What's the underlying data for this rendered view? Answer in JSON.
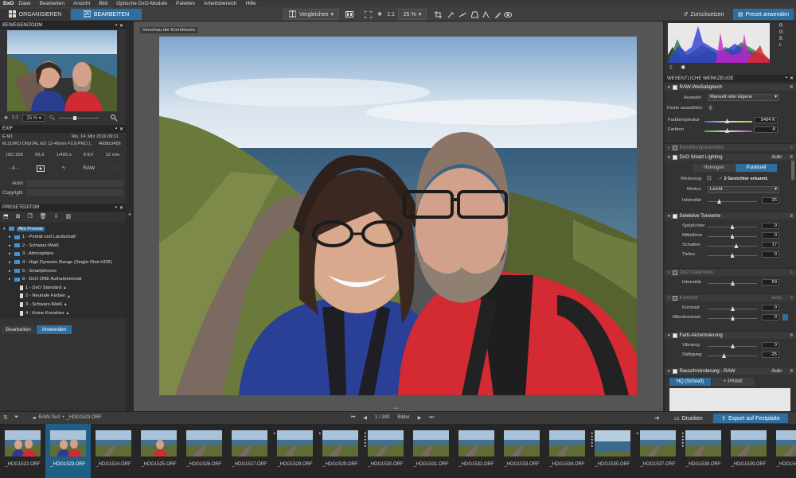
{
  "menubar": {
    "logo": "DxO",
    "items": [
      "Datei",
      "Bearbeiten",
      "Ansicht",
      "Bild",
      "Optische DxO-Module",
      "Paletten",
      "Arbeitsbereich",
      "Hilfe"
    ]
  },
  "toolbar": {
    "tab_organize": "ORGANISIEREN",
    "tab_edit": "BEARBEITEN",
    "compare_label": "Vergleichen",
    "ratio_label": "1:1",
    "zoom_value": "25 %",
    "reset_label": "Zurücksetzen",
    "apply_preset_label": "Preset anwenden",
    "tooltip": "Vorschau der Korrekturen"
  },
  "left": {
    "move_zoom": {
      "title": "BEWEGEN/ZOOM",
      "ratio": "1:1",
      "zoom": "25 %"
    },
    "exif": {
      "title": "EXIF",
      "camera": "E-M1",
      "date": "Mo, 14. Mrz 2016 09:11",
      "lens": "M.ZUIKO DIGITAL ED 12-40mm F2.8 PRO (...",
      "dimensions": "4608x3456",
      "iso": "ISO 200",
      "aperture": "f/6.3",
      "shutter": "1/400 s",
      "ev": "0 EV",
      "focal": "12 mm",
      "a_label": "- A -",
      "raw_label": "RAW",
      "author_label": "Autor",
      "copyright_label": "Copyright"
    },
    "preset_editor": {
      "title": "PRESETEDITOR",
      "tree": [
        {
          "label": "Alle Presets",
          "level": 0,
          "selected": true,
          "type": "folder"
        },
        {
          "label": "1 - Porträt und Landschaft",
          "level": 1,
          "type": "folder"
        },
        {
          "label": "2 - Schwarz-Weiß",
          "level": 1,
          "type": "folder"
        },
        {
          "label": "3 - Atmosphäre",
          "level": 1,
          "type": "folder"
        },
        {
          "label": "4 - High Dynamic Range (Single-Shot HDR)",
          "level": 1,
          "type": "folder"
        },
        {
          "label": "5 - Smartphones",
          "level": 1,
          "type": "folder"
        },
        {
          "label": "8 - DxO ONE Aufnahmemodi",
          "level": 1,
          "type": "folder"
        },
        {
          "label": "1 - DxO Standard",
          "level": 2,
          "type": "preset"
        },
        {
          "label": "2 - Neutrale Farben",
          "level": 2,
          "type": "preset"
        },
        {
          "label": "3 - Schwarz-Weiß",
          "level": 2,
          "type": "preset"
        },
        {
          "label": "4 - Keine Korrektur",
          "level": 2,
          "type": "preset"
        }
      ],
      "edit_button": "Bearbeiten",
      "apply_button": "Anwenden"
    }
  },
  "right": {
    "histogram_channels": [
      "R",
      "G",
      "B",
      "L"
    ],
    "essential_tools_title": "WESENTLICHE WERKZEUGE",
    "white_balance": {
      "title": "RAW-Weißabgleich",
      "selection_label": "Auswahl",
      "selection_value": "Manuell oder Eigene",
      "pick_color_label": "Farbe auswählen",
      "temp_label": "Farbtemperatur",
      "temp_value": "5494 K",
      "tint_label": "Farbton",
      "tint_value": "-8"
    },
    "exposure": {
      "title": "Belichtungskorrektur"
    },
    "smart_lighting": {
      "title": "DxO Smart Lighting",
      "auto": "Auto",
      "mode_homogen": "Homogen",
      "mode_spot": "Punktuell",
      "tool_label": "Werkzeug",
      "faces": "2 Gesichter erkannt.",
      "mode_label": "Modus",
      "mode_value": "Leicht",
      "intensity_label": "Intensität",
      "intensity_value": "25"
    },
    "tone": {
      "title": "Selektive Tonwerte",
      "rows": [
        {
          "label": "Spitzlichter",
          "value": "0",
          "pos": 0.5
        },
        {
          "label": "Mitteltöne",
          "value": "0",
          "pos": 0.5
        },
        {
          "label": "Schatten",
          "value": "17",
          "pos": 0.58
        },
        {
          "label": "Tiefen",
          "value": "0",
          "pos": 0.5
        }
      ]
    },
    "clearview": {
      "title": "DxO ClearView",
      "intensity_label": "Intensität",
      "intensity_value": "50"
    },
    "contrast": {
      "title": "Kontrast",
      "auto": "Auto",
      "contrast_label": "Kontrast",
      "contrast_value": "0",
      "micro_label": "Mikrokontrast",
      "micro_value": "0"
    },
    "color_accent": {
      "title": "Farb-Akzentuierung",
      "vibrancy_label": "Vibrancy",
      "vibrancy_value": "0",
      "saturation_label": "Sättigung",
      "saturation_value": "-25"
    },
    "noise": {
      "title": "Rauschminderung - RAW",
      "auto": "Auto",
      "mode_hq": "HQ (Schnell)",
      "mode_prime": "PRIME"
    }
  },
  "bottom": {
    "path": "RAW-Test",
    "current_file": "_HDG1523.ORF",
    "counter": "1 / 343",
    "images_label": "Bilder",
    "print_label": "Drucken",
    "export_label": "Export auf Festplatte"
  },
  "filmstrip": [
    {
      "name": "_HDG1522.ORF",
      "stars": 0,
      "kind": "people"
    },
    {
      "name": "_HDG1523.ORF",
      "stars": 0,
      "kind": "people",
      "selected": true
    },
    {
      "name": "_HDG1524.ORF",
      "stars": 0,
      "kind": "coast"
    },
    {
      "name": "_HDG1525.ORF",
      "stars": 0,
      "kind": "person"
    },
    {
      "name": "_HDG1526.ORF",
      "stars": 0,
      "kind": "coast"
    },
    {
      "name": "_HDG1527.ORF",
      "stars": 0,
      "kind": "coast"
    },
    {
      "name": "_HDG1528.ORF",
      "stars": 1,
      "kind": "coast"
    },
    {
      "name": "_HDG1529.ORF",
      "stars": 1,
      "kind": "coast"
    },
    {
      "name": "_HDG1530.ORF",
      "stars": 5,
      "kind": "coast"
    },
    {
      "name": "_HDG1531.ORF",
      "stars": 0,
      "kind": "coast"
    },
    {
      "name": "_HDG1532.ORF",
      "stars": 0,
      "kind": "coast"
    },
    {
      "name": "_HDG1533.ORF",
      "stars": 0,
      "kind": "coast"
    },
    {
      "name": "_HDG1534.ORF",
      "stars": 0,
      "kind": "coast"
    },
    {
      "name": "_HDG1535.ORF",
      "stars": 5,
      "kind": "sea"
    },
    {
      "name": "_HDG1537.ORF",
      "stars": 1,
      "kind": "coast"
    },
    {
      "name": "_HDG1538.ORF",
      "stars": 5,
      "kind": "coast"
    },
    {
      "name": "_HDG1539.ORF",
      "stars": 0,
      "kind": "coast"
    },
    {
      "name": "_HDG1540.ORF",
      "stars": 0,
      "kind": "coast"
    }
  ],
  "colors": {
    "accent": "#2f6fa0",
    "selected": "#1f5f86",
    "panel": "#333333"
  }
}
